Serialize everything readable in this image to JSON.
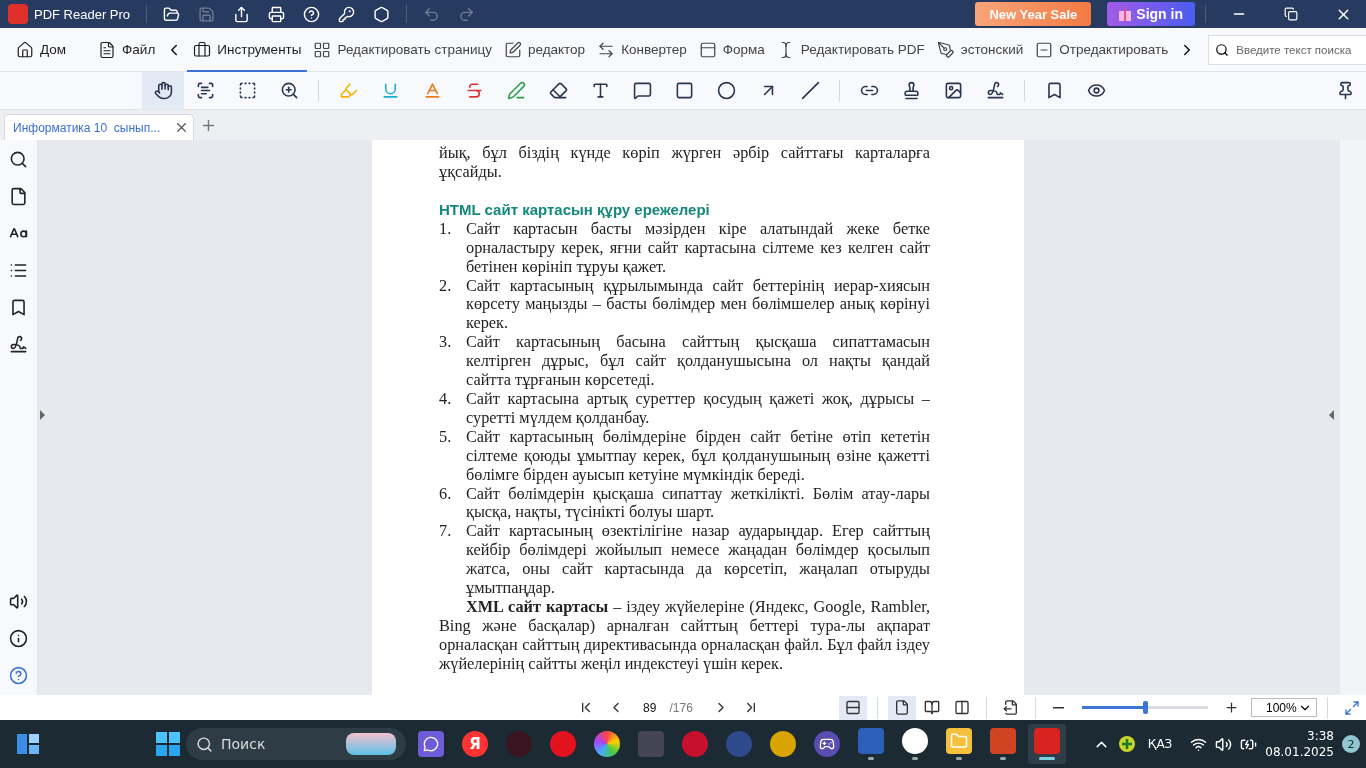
{
  "app": {
    "title": "PDF Reader Pro"
  },
  "promo": {
    "sale": "New Year Sale",
    "sign_in": "Sign in"
  },
  "menu": [
    {
      "kind": "home",
      "label": "Дом",
      "selected": false
    },
    {
      "kind": "file",
      "label": "Файл",
      "selected": false
    },
    {
      "kind": "tools",
      "label": "Инструменты",
      "selected": true
    },
    {
      "kind": "pages",
      "label": "Редактировать страницу",
      "selected": false
    },
    {
      "kind": "editor",
      "label": "редактор",
      "selected": false
    },
    {
      "kind": "convert",
      "label": "Конвертер",
      "selected": false
    },
    {
      "kind": "form",
      "label": "Форма",
      "selected": false
    },
    {
      "kind": "edit-pdf",
      "label": "Редактировать PDF",
      "selected": false
    },
    {
      "kind": "pen",
      "label": "эстонский",
      "selected": false
    },
    {
      "kind": "redact",
      "label": "Отредактировать",
      "selected": false
    }
  ],
  "search": {
    "placeholder": "Введите текст поиска"
  },
  "tool_groups": [
    {
      "tools": [
        {
          "kind": "hand",
          "selected": true
        },
        {
          "kind": "select-text",
          "selected": false
        },
        {
          "kind": "area",
          "selected": false
        },
        {
          "kind": "zoom-area",
          "selected": false
        }
      ]
    },
    {
      "tools": [
        {
          "kind": "highlight",
          "selected": false
        },
        {
          "kind": "underline",
          "selected": false
        },
        {
          "kind": "squiggly",
          "selected": false
        },
        {
          "kind": "strikeout",
          "selected": false
        },
        {
          "kind": "pen",
          "selected": false
        },
        {
          "kind": "eraser",
          "selected": false
        },
        {
          "kind": "text",
          "selected": false
        },
        {
          "kind": "note",
          "selected": false
        },
        {
          "kind": "rectangle",
          "selected": false
        },
        {
          "kind": "circle",
          "selected": false
        },
        {
          "kind": "arrow",
          "selected": false
        },
        {
          "kind": "line",
          "selected": false
        }
      ]
    },
    {
      "tools": [
        {
          "kind": "link",
          "selected": false
        },
        {
          "kind": "stamp",
          "selected": false
        },
        {
          "kind": "image",
          "selected": false
        },
        {
          "kind": "sign",
          "selected": false
        }
      ]
    },
    {
      "tools": [
        {
          "kind": "bookmark",
          "selected": false
        },
        {
          "kind": "eye",
          "selected": false
        }
      ]
    }
  ],
  "doc_tabs": [
    {
      "label": "Информатика 10  сынып...",
      "selected": true
    }
  ],
  "document": {
    "intro": "йық, бұл біздің күнде көріп жүрген әрбір сайттағы карталарға ұқсайды.",
    "heading": "HTML сайт картасын құру ережелері",
    "rules": [
      {
        "number": "1.",
        "text": "Сайт картасын басты мәзірден кіре алатындай жеке бетке орналастыру керек, яғни сайт картасына сілтеме кез келген сайт бетінен көрініп тұруы қажет."
      },
      {
        "number": "2.",
        "text": "Сайт картасының құрылымында сайт беттерінің иерар-хиясын көрсету маңызды – басты бөлімдер мен бөлімшелер анық көрінуі керек."
      },
      {
        "number": "3.",
        "text": "Сайт картасының басына сайттың қысқаша сипаттамасын келтірген дұрыс, бұл сайт қолданушысына ол нақты қандай сайтта тұрғанын көрсетеді."
      },
      {
        "number": "4.",
        "text": "Сайт картасына артық суреттер қосудың қажеті жоқ, дұрысы – суретті мүлдем қолданбау."
      },
      {
        "number": "5.",
        "text": "Сайт картасының бөлімдеріне бірден сайт бетіне өтіп кететін сілтеме қоюды ұмытпау керек, бұл қолданушының өзіне қажетті бөлімге бірден ауысып кетуіне мүмкіндік береді."
      },
      {
        "number": "6.",
        "text": "Сайт бөлімдерін қысқаша сипаттау жеткілікті. Бөлім атау-лары қысқа, нақты, түсінікті болуы шарт."
      },
      {
        "number": "7.",
        "text": "Сайт картасының өзектілігіне назар аударыңдар. Егер сайттың кейбір бөлімдері жойылып немесе жаңадан бөлімдер қосылып жатса, оны сайт картасында да көрсетіп, жаңалап отыруды ұмытпаңдар."
      }
    ],
    "paragraph": "**XML сайт картасы** – іздеу жүйелеріне (Яндекс, Google, Rambler, Bing және басқалар) арналған сайттың беттері тура-лы ақпарат орналасқан сайттың директивасында орналасқан файл. Бұл файл іздеу жүйелерінің сайтты жеңіл индекстеуі үшін керек."
  },
  "pager": {
    "page": "89",
    "total": "/176"
  },
  "view_modes": [
    {
      "kind": "fit-width",
      "selected": true
    },
    {
      "kind": "single",
      "selected": true
    },
    {
      "kind": "two-page",
      "selected": false
    },
    {
      "kind": "cover",
      "selected": false
    },
    {
      "kind": "extract",
      "selected": false
    }
  ],
  "zoom": {
    "level": 0.5,
    "value": "100%"
  },
  "taskbar": {
    "search_placeholder": "Поиск",
    "apps": [
      {
        "kind": "chat",
        "running": false,
        "selected": false
      },
      {
        "kind": "yandex",
        "glyph": "Я",
        "running": false,
        "selected": false
      },
      {
        "kind": "opera-gx",
        "running": false,
        "selected": false
      },
      {
        "kind": "opera",
        "running": false,
        "selected": false
      },
      {
        "kind": "color-ring",
        "running": false,
        "selected": false
      },
      {
        "kind": "tank",
        "running": false,
        "selected": false
      },
      {
        "kind": "m-logo",
        "running": false,
        "selected": false
      },
      {
        "kind": "y-circle",
        "running": false,
        "selected": false
      },
      {
        "kind": "diamond",
        "running": false,
        "selected": false
      },
      {
        "kind": "gamepad",
        "running": false,
        "selected": false
      },
      {
        "kind": "word",
        "running": true,
        "selected": false
      },
      {
        "kind": "y-browser",
        "running": true,
        "selected": false
      },
      {
        "kind": "folder",
        "running": true,
        "selected": false
      },
      {
        "kind": "powerpoint",
        "running": true,
        "selected": false
      },
      {
        "kind": "pdf",
        "running": true,
        "selected": true
      }
    ],
    "language": "ҚАЗ",
    "time": "3:38",
    "date": "08.01.2025",
    "notifications": "2"
  }
}
